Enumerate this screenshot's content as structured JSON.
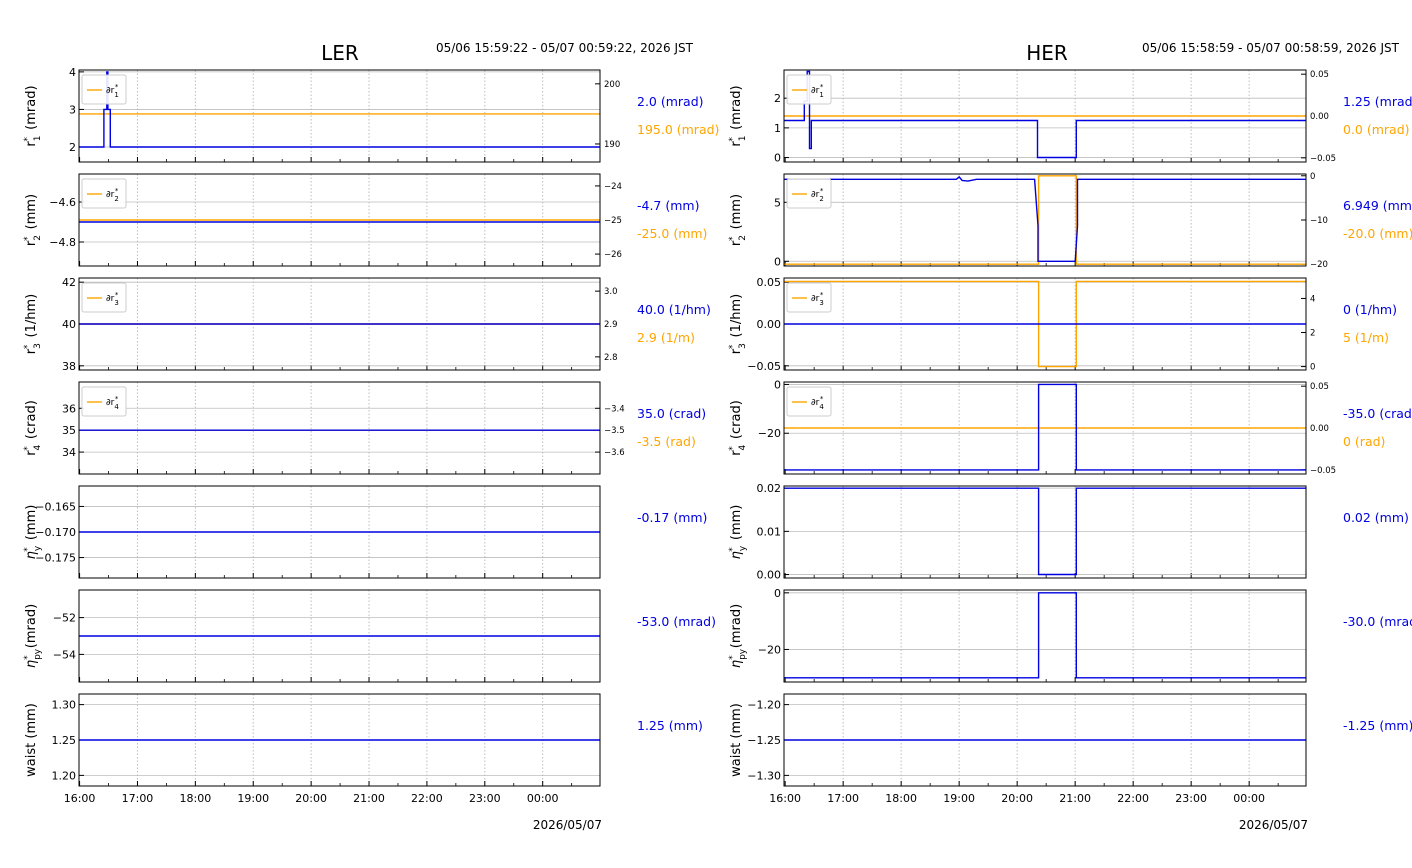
{
  "colors": {
    "primary": "#0000e0",
    "secondary": "#ffa500",
    "grid": "#bdbdbd",
    "axis": "#000000"
  },
  "chart_data": [
    {
      "type": "line",
      "title": "LER",
      "time_range": "05/06 15:59:22 - 05/07 00:59:22, 2026 JST",
      "xlabel": "2026/05/07",
      "x_ticks": [
        "16:00",
        "17:00",
        "18:00",
        "19:00",
        "20:00",
        "21:00",
        "22:00",
        "23:00",
        "00:00"
      ],
      "xlim": [
        -0.01,
        8.99
      ],
      "panels": [
        {
          "ylabel": "r₁* (mrad)",
          "ylim": [
            1.6,
            4.05
          ],
          "yticks": [
            "2",
            "3",
            "4"
          ],
          "ytick_values": [
            2,
            3,
            4
          ],
          "series": [
            {
              "x": [
                -0.01,
                0.42,
                0.42,
                0.47,
                0.47,
                0.49,
                0.49,
                0.53,
                0.53,
                8.99
              ],
              "y": [
                2.0,
                2.0,
                3.0,
                3.0,
                4.0,
                4.0,
                3.0,
                3.0,
                2.0,
                2.0
              ]
            }
          ],
          "secondary": {
            "name": "∂r₁*",
            "ylim": [
              187,
              202.3
            ],
            "yticks": [
              "190",
              "200"
            ],
            "ytick_values": [
              190,
              200
            ],
            "x": [
              -0.01,
              8.99
            ],
            "y": [
              195.0,
              195.0
            ]
          },
          "current_value": "2.0 (mrad)",
          "current_secondary": "195.0 (mrad)"
        },
        {
          "ylabel": "r₂* (mm)",
          "ylim": [
            -4.92,
            -4.46
          ],
          "yticks": [
            "−4.6",
            "−4.8"
          ],
          "ytick_values": [
            -4.6,
            -4.8
          ],
          "series": [
            {
              "x": [
                -0.01,
                8.99
              ],
              "y": [
                -4.7,
                -4.7
              ]
            }
          ],
          "secondary": {
            "name": "∂r₂*",
            "ylim": [
              -26.35,
              -23.65
            ],
            "yticks": [
              "−24",
              "−25",
              "−26"
            ],
            "ytick_values": [
              -24,
              -25,
              -26
            ],
            "x": [
              -0.01,
              8.99
            ],
            "y": [
              -25.0,
              -25.0
            ]
          },
          "current_value": "-4.7 (mm)",
          "current_secondary": "-25.0 (mm)"
        },
        {
          "ylabel": "r₃* (1/hm)",
          "ylim": [
            37.8,
            42.2
          ],
          "yticks": [
            "42",
            "40",
            "38"
          ],
          "ytick_values": [
            42,
            40,
            38
          ],
          "series": [
            {
              "x": [
                -0.01,
                8.99
              ],
              "y": [
                40.0,
                40.0
              ]
            }
          ],
          "secondary": {
            "name": "∂r₃*",
            "ylim": [
              2.76,
              3.04
            ],
            "yticks": [
              "3.0",
              "2.9",
              "2.8"
            ],
            "ytick_values": [
              3.0,
              2.9,
              2.8
            ],
            "x": [
              -0.01,
              8.99
            ],
            "y": [
              2.9,
              2.9
            ]
          },
          "current_value": "40.0 (1/hm)",
          "current_secondary": "2.9 (1/m)"
        },
        {
          "ylabel": "r₄* (crad)",
          "ylim": [
            33.0,
            37.2
          ],
          "yticks": [
            "36",
            "35",
            "34"
          ],
          "ytick_values": [
            36,
            35,
            34
          ],
          "series": [
            {
              "x": [
                -0.01,
                8.99
              ],
              "y": [
                35.0,
                35.0
              ]
            }
          ],
          "secondary": {
            "name": "∂r₄*",
            "ylim": [
              -3.7,
              -3.28
            ],
            "yticks": [
              "−3.4",
              "−3.5",
              "−3.6"
            ],
            "ytick_values": [
              -3.4,
              -3.5,
              -3.6
            ],
            "x": [
              -0.01,
              8.99
            ],
            "y": [
              -3.5,
              -3.5
            ]
          },
          "current_value": "35.0 (crad)",
          "current_secondary": "-3.5 (rad)"
        },
        {
          "ylabel": "η_y* (mm)",
          "ylim": [
            -0.179,
            -0.161
          ],
          "yticks": [
            "−0.165",
            "−0.170",
            "−0.175"
          ],
          "ytick_values": [
            -0.165,
            -0.17,
            -0.175
          ],
          "series": [
            {
              "x": [
                -0.01,
                8.99
              ],
              "y": [
                -0.17,
                -0.17
              ]
            }
          ],
          "current_value": "-0.17 (mm)"
        },
        {
          "ylabel": "η_py* (mrad)",
          "ylim": [
            -55.5,
            -50.5
          ],
          "yticks": [
            "−52",
            "−54"
          ],
          "ytick_values": [
            -52,
            -54
          ],
          "series": [
            {
              "x": [
                -0.01,
                8.99
              ],
              "y": [
                -53.0,
                -53.0
              ]
            }
          ],
          "current_value": "-53.0 (mrad)"
        },
        {
          "ylabel": "waist (mm)",
          "ylim": [
            1.185,
            1.315
          ],
          "yticks": [
            "1.30",
            "1.25",
            "1.20"
          ],
          "ytick_values": [
            1.3,
            1.25,
            1.2
          ],
          "series": [
            {
              "x": [
                -0.01,
                8.99
              ],
              "y": [
                1.25,
                1.25
              ]
            }
          ],
          "current_value": "1.25 (mm)"
        }
      ]
    },
    {
      "type": "line",
      "title": "HER",
      "time_range": "05/06 15:58:59 - 05/07 00:58:59, 2026 JST",
      "xlabel": "2026/05/07",
      "x_ticks": [
        "16:00",
        "17:00",
        "18:00",
        "19:00",
        "20:00",
        "21:00",
        "22:00",
        "23:00",
        "00:00"
      ],
      "xlim": [
        -0.02,
        8.98
      ],
      "panels": [
        {
          "ylabel": "r₁* (mrad)",
          "ylim": [
            -0.15,
            2.95
          ],
          "yticks": [
            "2",
            "1",
            "0"
          ],
          "ytick_values": [
            2,
            1,
            0
          ],
          "series": [
            {
              "x": [
                -0.02,
                0.33,
                0.33,
                0.38,
                0.38,
                0.42,
                0.42,
                0.45,
                0.45,
                4.35,
                4.35,
                5.02,
                5.02,
                8.98
              ],
              "y": [
                1.25,
                1.25,
                1.9,
                1.9,
                2.9,
                2.9,
                0.3,
                0.3,
                1.25,
                1.25,
                0.0,
                0.0,
                1.25,
                1.25
              ]
            }
          ],
          "secondary": {
            "name": "∂r₁*",
            "ylim": [
              -0.055,
              0.055
            ],
            "yticks": [
              "0.05",
              "0.00",
              "−0.05"
            ],
            "ytick_values": [
              0.05,
              0.0,
              -0.05
            ],
            "x": [
              -0.02,
              8.98
            ],
            "y": [
              0.0,
              0.0
            ]
          },
          "current_value": "1.25 (mrad)",
          "current_secondary": "0.0 (mrad)"
        },
        {
          "ylabel": "r₂* (mm)",
          "ylim": [
            -0.4,
            7.4
          ],
          "yticks": [
            "5",
            "0"
          ],
          "ytick_values": [
            5,
            0
          ],
          "series": [
            {
              "x": [
                -0.02,
                2.95,
                3.0,
                3.05,
                3.15,
                3.3,
                4.3,
                4.36,
                4.36,
                5.0,
                5.04,
                5.04,
                8.98
              ],
              "y": [
                6.949,
                6.949,
                7.15,
                6.85,
                6.8,
                6.949,
                6.949,
                3.0,
                0.0,
                0.0,
                3.0,
                6.949,
                6.949
              ]
            }
          ],
          "secondary": {
            "name": "∂r₂*",
            "ylim": [
              -20.4,
              0.4
            ],
            "yticks": [
              "0",
              "−10",
              "−20"
            ],
            "ytick_values": [
              0,
              -10,
              -20
            ],
            "x": [
              -0.02,
              4.37,
              4.37,
              5.02,
              5.02,
              8.98
            ],
            "y": [
              -20.0,
              -20.0,
              0.0,
              0.0,
              -20.0,
              -20.0
            ]
          },
          "current_value": "6.949 (mm)",
          "current_secondary": "-20.0 (mm)"
        },
        {
          "ylabel": "r₃* (1/hm)",
          "ylim": [
            -0.055,
            0.055
          ],
          "yticks": [
            "0.05",
            "0.00",
            "−0.05"
          ],
          "ytick_values": [
            0.05,
            0.0,
            -0.05
          ],
          "series": [
            {
              "x": [
                -0.02,
                8.98
              ],
              "y": [
                0.0,
                0.0
              ]
            }
          ],
          "secondary": {
            "name": "∂r₃*",
            "ylim": [
              -0.2,
              5.2
            ],
            "yticks": [
              "4",
              "2",
              "0"
            ],
            "ytick_values": [
              4,
              2,
              0
            ],
            "x": [
              -0.02,
              4.37,
              4.37,
              5.02,
              5.02,
              8.98
            ],
            "y": [
              5.0,
              5.0,
              0.0,
              0.0,
              5.0,
              5.0
            ]
          },
          "current_value": "0 (1/hm)",
          "current_secondary": "5 (1/m)"
        },
        {
          "ylabel": "r₄* (crad)",
          "ylim": [
            -36.7,
            1.0
          ],
          "yticks": [
            "0",
            "−20"
          ],
          "ytick_values": [
            0,
            -20
          ],
          "series": [
            {
              "x": [
                -0.02,
                4.37,
                4.37,
                5.02,
                5.02,
                8.98
              ],
              "y": [
                -35.0,
                -35.0,
                0.0,
                0.0,
                -35.0,
                -35.0
              ]
            }
          ],
          "secondary": {
            "name": "∂r₄*",
            "ylim": [
              -0.055,
              0.055
            ],
            "yticks": [
              "0.05",
              "0.00",
              "−0.05"
            ],
            "ytick_values": [
              0.05,
              0.0,
              -0.05
            ],
            "x": [
              -0.02,
              8.98
            ],
            "y": [
              0.0,
              0.0
            ]
          },
          "current_value": "-35.0 (crad)",
          "current_secondary": "0 (rad)"
        },
        {
          "ylabel": "η_y* (mm)",
          "ylim": [
            -0.0008,
            0.0205
          ],
          "yticks": [
            "0.02",
            "0.01",
            "0.00"
          ],
          "ytick_values": [
            0.02,
            0.01,
            0.0
          ],
          "series": [
            {
              "x": [
                -0.02,
                4.37,
                4.37,
                5.02,
                5.02,
                8.98
              ],
              "y": [
                0.02,
                0.02,
                0.0,
                0.0,
                0.02,
                0.02
              ]
            }
          ],
          "current_value": "0.02 (mm)"
        },
        {
          "ylabel": "η_py* (mrad)",
          "ylim": [
            -31.5,
            1.0
          ],
          "yticks": [
            "0",
            "−20"
          ],
          "ytick_values": [
            0,
            -20
          ],
          "series": [
            {
              "x": [
                -0.02,
                4.37,
                4.37,
                5.02,
                5.02,
                8.98
              ],
              "y": [
                -30.0,
                -30.0,
                0.0,
                0.0,
                -30.0,
                -30.0
              ]
            }
          ],
          "current_value": "-30.0 (mrad)"
        },
        {
          "ylabel": "waist (mm)",
          "ylim": [
            -1.315,
            -1.185
          ],
          "yticks": [
            "−1.20",
            "−1.25",
            "−1.30"
          ],
          "ytick_values": [
            -1.2,
            -1.25,
            -1.3
          ],
          "series": [
            {
              "x": [
                -0.02,
                8.98
              ],
              "y": [
                -1.25,
                -1.25
              ]
            }
          ],
          "current_value": "-1.25 (mm)"
        }
      ]
    }
  ]
}
